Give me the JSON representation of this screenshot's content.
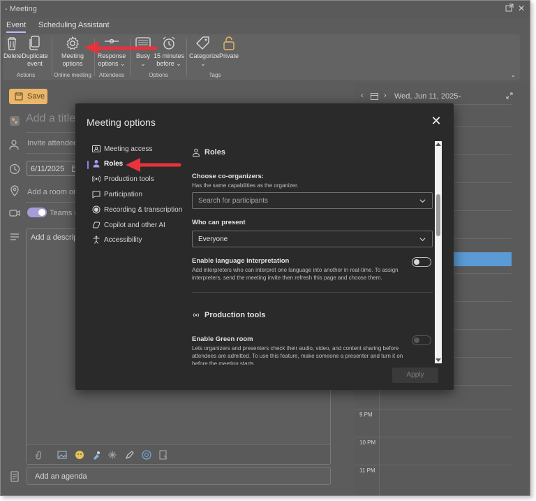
{
  "window": {
    "title": "- Meeting"
  },
  "tabs": [
    {
      "label": "Event",
      "active": true
    },
    {
      "label": "Scheduling Assistant",
      "active": false
    }
  ],
  "ribbon": {
    "groups": {
      "actions": "Actions",
      "online_meeting": "Online meeting",
      "attendees": "Attendees",
      "options": "Options",
      "tags": "Tags"
    },
    "buttons": {
      "delete": "Delete",
      "duplicate_1": "Duplicate",
      "duplicate_2": "event",
      "meeting_options_1": "Meeting",
      "meeting_options_2": "options",
      "response_1": "Response",
      "response_2": "options",
      "busy": "Busy",
      "reminder_1": "15 minutes",
      "reminder_2": "before",
      "categorize": "Categorize",
      "private": "Private"
    }
  },
  "form": {
    "save_label": "Save",
    "title_placeholder": "Add a title",
    "attendees_placeholder": "Invite attendees",
    "start_date": "6/11/2025",
    "location_placeholder": "Add a room or l",
    "teams_label": "Teams m",
    "description_placeholder": "Add a descripti",
    "agenda_label": "Add an agenda"
  },
  "calendar": {
    "date_label": "Wed, Jun 11, 2025",
    "hours": [
      "9 PM",
      "10 PM",
      "11 PM"
    ]
  },
  "dialog": {
    "title": "Meeting options",
    "nav": [
      {
        "label": "Meeting access",
        "icon": "meeting-access-icon",
        "active": false
      },
      {
        "label": "Roles",
        "icon": "person-icon",
        "active": true
      },
      {
        "label": "Production tools",
        "icon": "broadcast-icon",
        "active": false
      },
      {
        "label": "Participation",
        "icon": "chat-icon",
        "active": false
      },
      {
        "label": "Recording & transcription",
        "icon": "record-icon",
        "active": false
      },
      {
        "label": "Copilot and other AI",
        "icon": "copilot-icon",
        "active": false
      },
      {
        "label": "Accessibility",
        "icon": "accessibility-icon",
        "active": false
      }
    ],
    "roles": {
      "heading": "Roles",
      "coorganizers_label": "Choose co-organizers:",
      "coorganizers_desc": "Has the same capabilities as the organizer.",
      "search_placeholder": "Search for participants",
      "who_can_present_label": "Who can present",
      "who_can_present_value": "Everyone",
      "interpretation_label": "Enable language interpretation",
      "interpretation_desc": "Add interpreters who can interpret one language into another in real-time. To assign interpreters, send the meeting invite then refresh this page and choose them.",
      "interpretation_on": false
    },
    "production": {
      "heading": "Production tools",
      "green_room_label": "Enable Green room",
      "green_room_desc": "Lets organizers and presenters check their audio, video, and content sharing before attendees are admitted. To use this feature, make someone a presenter and turn it on before the meeting starts.",
      "green_room_on": false
    },
    "apply_label": "Apply"
  },
  "colors": {
    "accent": "#8e85e8",
    "annotation_arrow": "#e8323c",
    "save_button": "#e9b66a",
    "calendar_event": "#5b9bd5"
  }
}
